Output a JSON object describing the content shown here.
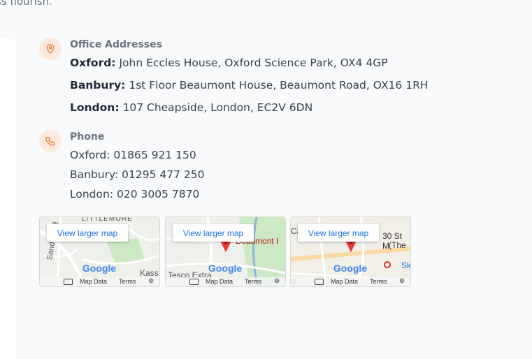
{
  "intro": {
    "tail_text": "ss flourish."
  },
  "addresses": {
    "title": "Office Addresses",
    "items": [
      {
        "label": "Oxford:",
        "value": "John Eccles House, Oxford Science Park, OX4 4GP"
      },
      {
        "label": "Banbury:",
        "value": "1st Floor Beaumont House, Beaumont Road, OX16 1RH"
      },
      {
        "label": "London:",
        "value": "107 Cheapside, London, EC2V 6DN"
      }
    ]
  },
  "phone": {
    "title": "Phone",
    "items": [
      "Oxford: 01865 921 150",
      "Banbury: 01295 477 250",
      "London: 020 3005 7870"
    ]
  },
  "maps": [
    {
      "button": "View larger map",
      "labels": [
        "LITTLEMORE",
        "Sandford R",
        "Kass"
      ],
      "footer": {
        "map_data": "Map Data",
        "terms": "Terms"
      },
      "logo": "Google"
    },
    {
      "button": "View larger map",
      "labels": [
        "Beaumont I",
        "Tesco Extra"
      ],
      "footer": {
        "map_data": "Map Data",
        "terms": "Terms"
      },
      "logo": "Google"
    },
    {
      "button": "View larger map",
      "labels": [
        "Ca",
        "30 St M",
        "(The",
        "Sk",
        "s"
      ],
      "footer": {
        "map_data": "Map Data",
        "terms": "Terms"
      },
      "logo": "Google"
    }
  ],
  "colors": {
    "accent": "#f07a3c",
    "badge_bg": "#fde9dc",
    "marker": "#e53935",
    "link": "#1a73e8"
  },
  "icons": {
    "addresses": "location-pin-icon",
    "phone": "phone-icon",
    "map_marker": "map-marker-icon",
    "keyboard": "keyboard-icon",
    "settings": "gear-icon"
  }
}
